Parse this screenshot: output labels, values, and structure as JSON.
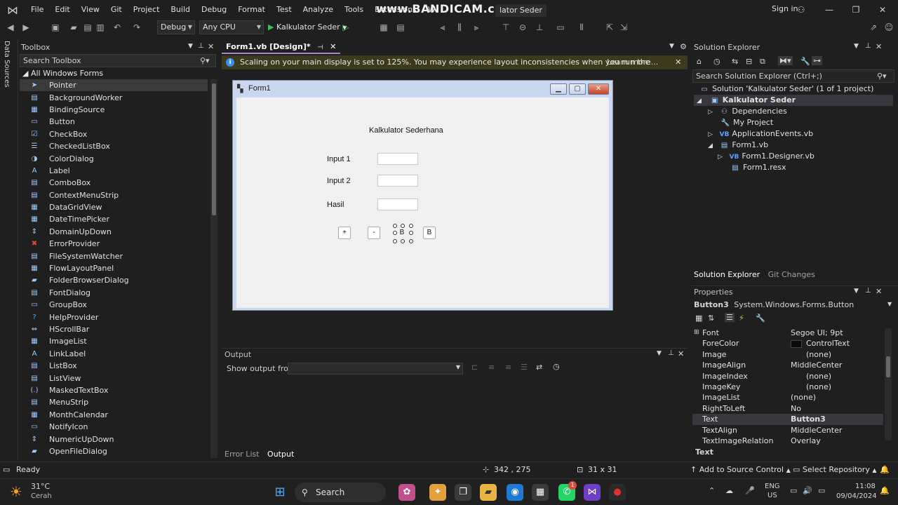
{
  "menubar": {
    "items": [
      "File",
      "Edit",
      "View",
      "Git",
      "Project",
      "Build",
      "Debug",
      "Format",
      "Test",
      "Analyze",
      "Tools",
      "Extensions",
      "W"
    ],
    "watermark": "www.BANDICAM.com",
    "title_tail": "lator Seder",
    "sign_in": "Sign in"
  },
  "toolbar": {
    "config": "Debug",
    "platform": "Any CPU",
    "startup": "Kalkulator Seder"
  },
  "side_strip": {
    "label": "Data Sources"
  },
  "toolbox": {
    "title": "Toolbox",
    "search_placeholder": "Search Toolbox",
    "group": "All Windows Forms",
    "items": [
      {
        "label": "Pointer",
        "icon": "pointer-icon"
      },
      {
        "label": "BackgroundWorker",
        "icon": "backgroundworker-icon"
      },
      {
        "label": "BindingSource",
        "icon": "bindingsource-icon"
      },
      {
        "label": "Button",
        "icon": "button-icon"
      },
      {
        "label": "CheckBox",
        "icon": "checkbox-icon"
      },
      {
        "label": "CheckedListBox",
        "icon": "checkedlistbox-icon"
      },
      {
        "label": "ColorDialog",
        "icon": "colordialog-icon"
      },
      {
        "label": "Label",
        "icon": "label-icon"
      },
      {
        "label": "ComboBox",
        "icon": "combobox-icon"
      },
      {
        "label": "ContextMenuStrip",
        "icon": "contextmenustrip-icon"
      },
      {
        "label": "DataGridView",
        "icon": "datagridview-icon"
      },
      {
        "label": "DateTimePicker",
        "icon": "datetimepicker-icon"
      },
      {
        "label": "DomainUpDown",
        "icon": "domainupdown-icon"
      },
      {
        "label": "ErrorProvider",
        "icon": "errorprovider-icon"
      },
      {
        "label": "FileSystemWatcher",
        "icon": "filesystemwatcher-icon"
      },
      {
        "label": "FlowLayoutPanel",
        "icon": "flowlayoutpanel-icon"
      },
      {
        "label": "FolderBrowserDialog",
        "icon": "folderbrowserdialog-icon"
      },
      {
        "label": "FontDialog",
        "icon": "fontdialog-icon"
      },
      {
        "label": "GroupBox",
        "icon": "groupbox-icon"
      },
      {
        "label": "HelpProvider",
        "icon": "helpprovider-icon"
      },
      {
        "label": "HScrollBar",
        "icon": "hscrollbar-icon"
      },
      {
        "label": "ImageList",
        "icon": "imagelist-icon"
      },
      {
        "label": "LinkLabel",
        "icon": "linklabel-icon"
      },
      {
        "label": "ListBox",
        "icon": "listbox-icon"
      },
      {
        "label": "ListView",
        "icon": "listview-icon"
      },
      {
        "label": "MaskedTextBox",
        "icon": "maskedtextbox-icon"
      },
      {
        "label": "MenuStrip",
        "icon": "menustrip-icon"
      },
      {
        "label": "MonthCalendar",
        "icon": "monthcalendar-icon"
      },
      {
        "label": "NotifyIcon",
        "icon": "notifyicon-icon"
      },
      {
        "label": "NumericUpDown",
        "icon": "numericupdown-icon"
      },
      {
        "label": "OpenFileDialog",
        "icon": "openfiledialog-icon"
      }
    ]
  },
  "document": {
    "tab": "Form1.vb [Design]*",
    "info": "Scaling on your main display is set to 125%. You may experience layout inconsistencies when you run the application.",
    "info_link": "Learn more..."
  },
  "form": {
    "caption": "Form1",
    "heading": "Kalkulator Sederhana",
    "label1": "Input 1",
    "label2": "Input 2",
    "label3": "Hasil",
    "btn_plus": "+",
    "btn_minus": "-",
    "btn_b_selected": "B",
    "btn_b": "B"
  },
  "output": {
    "title": "Output",
    "show_from": "Show output from:",
    "tabs": [
      "Error List",
      "Output"
    ]
  },
  "solution_explorer": {
    "title": "Solution Explorer",
    "search_placeholder": "Search Solution Explorer (Ctrl+;)",
    "solution": "Solution 'Kalkulator Seder' (1 of 1 project)",
    "project": "Kalkulator Seder",
    "nodes": [
      "Dependencies",
      "My Project",
      "ApplicationEvents.vb",
      "Form1.vb",
      "Form1.Designer.vb",
      "Form1.resx"
    ],
    "tabs": [
      "Solution Explorer",
      "Git Changes"
    ]
  },
  "properties": {
    "title": "Properties",
    "object": "Button3",
    "object_type": "System.Windows.Forms.Button",
    "rows": [
      {
        "name": "Font",
        "value": "Segoe UI; 9pt"
      },
      {
        "name": "ForeColor",
        "value": "ControlText"
      },
      {
        "name": "Image",
        "value": "(none)"
      },
      {
        "name": "ImageAlign",
        "value": "MiddleCenter"
      },
      {
        "name": "ImageIndex",
        "value": "(none)"
      },
      {
        "name": "ImageKey",
        "value": "(none)"
      },
      {
        "name": "ImageList",
        "value": "(none)"
      },
      {
        "name": "RightToLeft",
        "value": "No"
      },
      {
        "name": "Text",
        "value": "Button3"
      },
      {
        "name": "TextAlign",
        "value": "MiddleCenter"
      },
      {
        "name": "TextImageRelation",
        "value": "Overlay"
      }
    ],
    "description": "Text"
  },
  "statusbar": {
    "ready": "Ready",
    "position": "342 , 275",
    "size": "31 x 31",
    "add_source": "Add to Source Control",
    "select_repo": "Select Repository"
  },
  "taskbar": {
    "temp": "31°C",
    "weather": "Cerah",
    "search": "Search",
    "lang1": "ENG",
    "lang2": "US",
    "time": "11:08",
    "date": "09/04/2024",
    "notif_badge": "1"
  },
  "colors": {
    "accent": "#b180d7",
    "info_bg": "#3b3a1d",
    "form_frame": "#c9d8ee"
  }
}
